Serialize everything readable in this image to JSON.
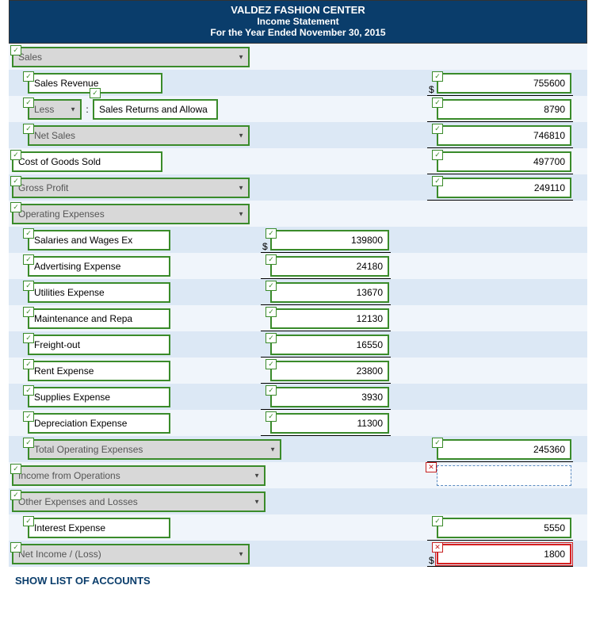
{
  "header": {
    "company": "VALDEZ FASHION CENTER",
    "title": "Income Statement",
    "period": "For the Year Ended November 30, 2015"
  },
  "rows": {
    "sales": "Sales",
    "salesRevenue": "Sales Revenue",
    "salesRevenueVal": "755600",
    "less": "Less",
    "salesReturns": "Sales Returns and Allowa",
    "salesReturnsVal": "8790",
    "netSales": "Net Sales",
    "netSalesVal": "746810",
    "cogs": "Cost of Goods Sold",
    "cogsVal": "497700",
    "grossProfit": "Gross Profit",
    "grossProfitVal": "249110",
    "opEx": "Operating Expenses",
    "salaries": "Salaries and Wages Ex",
    "salariesVal": "139800",
    "advertising": "Advertising Expense",
    "advertisingVal": "24180",
    "utilities": "Utilities Expense",
    "utilitiesVal": "13670",
    "maintenance": "Maintenance and Repa",
    "maintenanceVal": "12130",
    "freight": "Freight-out",
    "freightVal": "16550",
    "rent": "Rent Expense",
    "rentVal": "23800",
    "supplies": "Supplies Expense",
    "suppliesVal": "3930",
    "depreciation": "Depreciation Expense",
    "depreciationVal": "11300",
    "totalOpEx": "Total Operating Expenses",
    "totalOpExVal": "245360",
    "incomeOps": "Income from Operations",
    "incomeOpsVal": "",
    "otherExp": "Other Expenses and Losses",
    "interest": "Interest Expense",
    "interestVal": "5550",
    "netIncome": "Net Income / (Loss)",
    "netIncomeVal": "1800"
  },
  "link": "SHOW LIST OF ACCOUNTS"
}
